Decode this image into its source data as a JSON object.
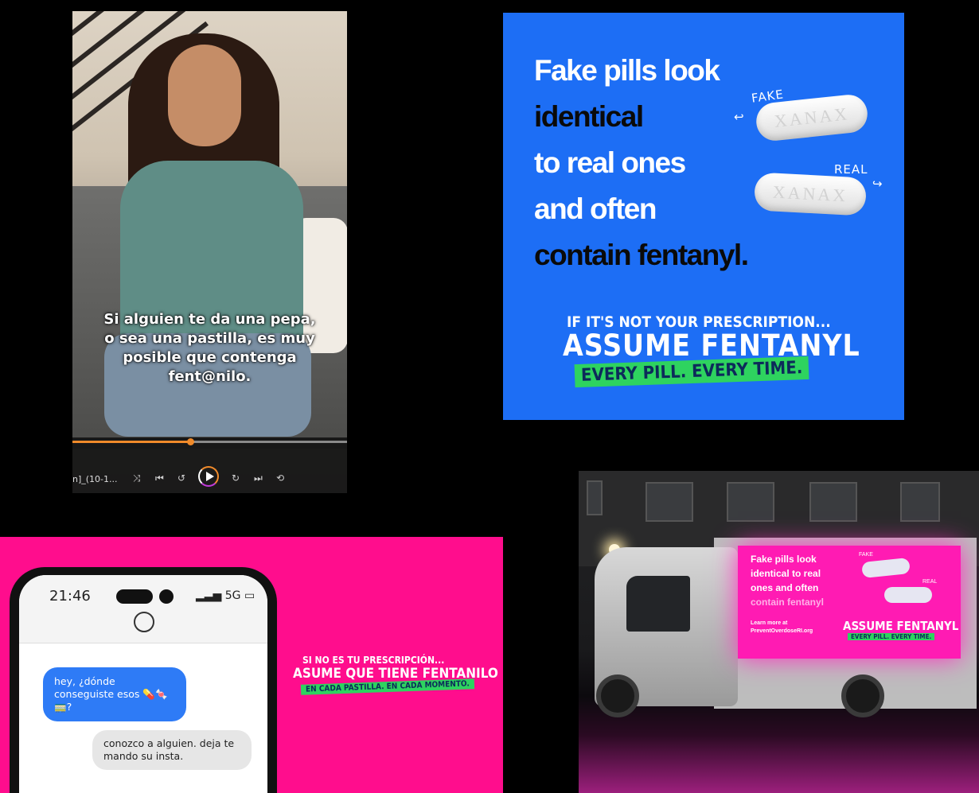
{
  "video_panel": {
    "subtitle_lines": [
      "Si alguien te da una pepa,",
      "o sea una pastilla, es muy",
      "posible que contenga",
      "fent@nilo."
    ],
    "progress": 0.43,
    "file_label": "n]_(10-1...",
    "icons": [
      "shuffle-icon",
      "previous-icon",
      "rewind-icon",
      "play-icon",
      "forward-icon",
      "next-icon",
      "repeat-icon"
    ]
  },
  "blue_poster": {
    "lines": [
      {
        "text": "Fake pills look",
        "color": "#ffffff"
      },
      {
        "text": "identical",
        "color": "#0a0a0a"
      },
      {
        "text": "to real ones",
        "color": "#ffffff"
      },
      {
        "text": "and often",
        "color": "#ffffff"
      },
      {
        "text": "contain fentanyl.",
        "color": "#0a0a0a"
      }
    ],
    "pill_fake_label": "FAKE",
    "pill_real_label": "REAL",
    "pill_imprint": "XANAX",
    "tagline_small": "IF IT'S NOT YOUR PRESCRIPTION...",
    "tagline_big": "ASSUME FENTANYL",
    "tagline_highlight": "EVERY PILL. EVERY TIME.",
    "bg_color": "#1d6ef5",
    "highlight_color": "#2ed35f"
  },
  "phone_panel": {
    "time": "21:46",
    "network": "5G",
    "message_in": "hey, ¿dónde conseguiste esos 💊🍬🚃?",
    "message_out": "conozco a alguien. deja te mando su insta.",
    "tagline_small": "SI NO ES TU PRESCRIPCIÓN...",
    "tagline_big": "ASUME QUE TIENE FENTANILO",
    "tagline_highlight": "EN CADA PASTILLA. EN CADA MOMENTO.",
    "bg_color": "#ff0d8d"
  },
  "truck_panel": {
    "billboard_lines": [
      "Fake pills look",
      "identical to real",
      "ones and often",
      "contain fentanyl"
    ],
    "learn_more": "Learn more at",
    "url": "PreventOverdoseRI.org",
    "fake_label": "FAKE",
    "real_label": "REAL",
    "tagline_big": "ASSUME FENTANYL",
    "tagline_highlight": "EVERY PILL. EVERY TIME."
  }
}
